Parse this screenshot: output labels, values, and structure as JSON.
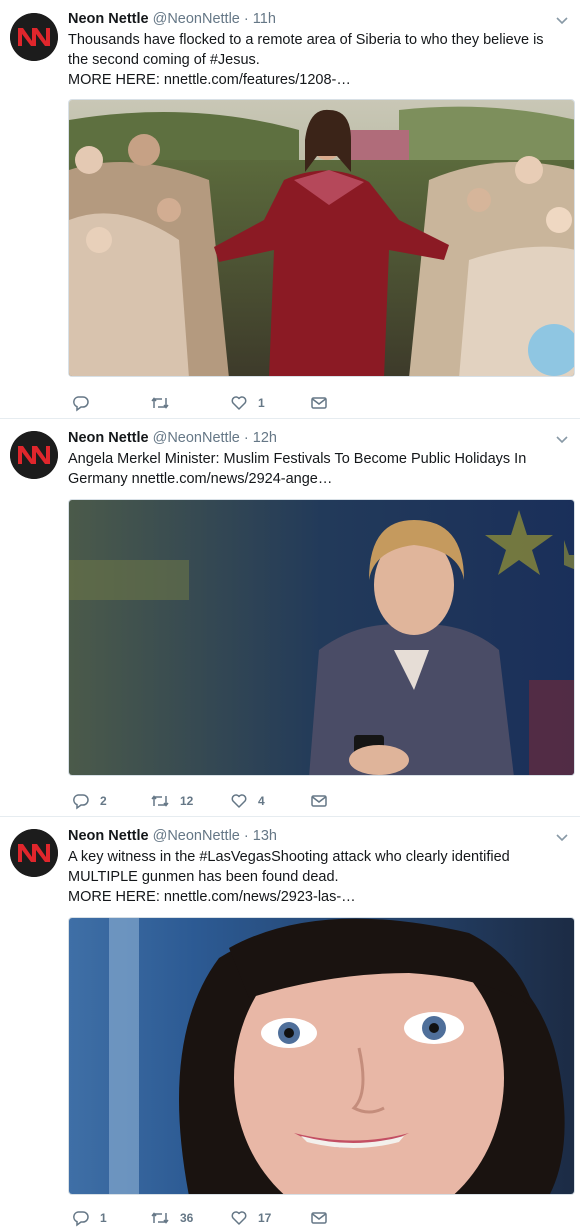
{
  "tweets": [
    {
      "name": "Neon Nettle",
      "handle": "@NeonNettle",
      "separator": "·",
      "time": "11h",
      "text_lines": [
        "Thousands have flocked to a remote area of Siberia to who they believe is",
        "the second coming of #Jesus.",
        "MORE HERE: nnettle.com/features/1208-…"
      ],
      "replies": "",
      "retweets": "",
      "likes": "1"
    },
    {
      "name": "Neon Nettle",
      "handle": "@NeonNettle",
      "separator": "·",
      "time": "12h",
      "text_lines": [
        "Angela Merkel Minister: Muslim Festivals To Become Public Holidays In",
        "Germany nnettle.com/news/2924-ange…"
      ],
      "replies": "2",
      "retweets": "12",
      "likes": "4"
    },
    {
      "name": "Neon Nettle",
      "handle": "@NeonNettle",
      "separator": "·",
      "time": "13h",
      "text_lines": [
        "A key witness in the #LasVegasShooting attack who clearly identified",
        "MULTIPLE gunmen has been found dead.",
        "MORE HERE: nnettle.com/news/2923-las-…"
      ],
      "replies": "1",
      "retweets": "36",
      "likes": "17"
    }
  ],
  "icons": {
    "avatar": "neon-nettle-logo",
    "menu": "chevron-down-icon",
    "reply": "reply-icon",
    "retweet": "retweet-icon",
    "like": "heart-icon",
    "dm": "envelope-icon"
  },
  "colors": {
    "name": "#14171a",
    "meta": "#657786",
    "avatar_red": "#e0262c",
    "divider": "#e6ecf0"
  }
}
